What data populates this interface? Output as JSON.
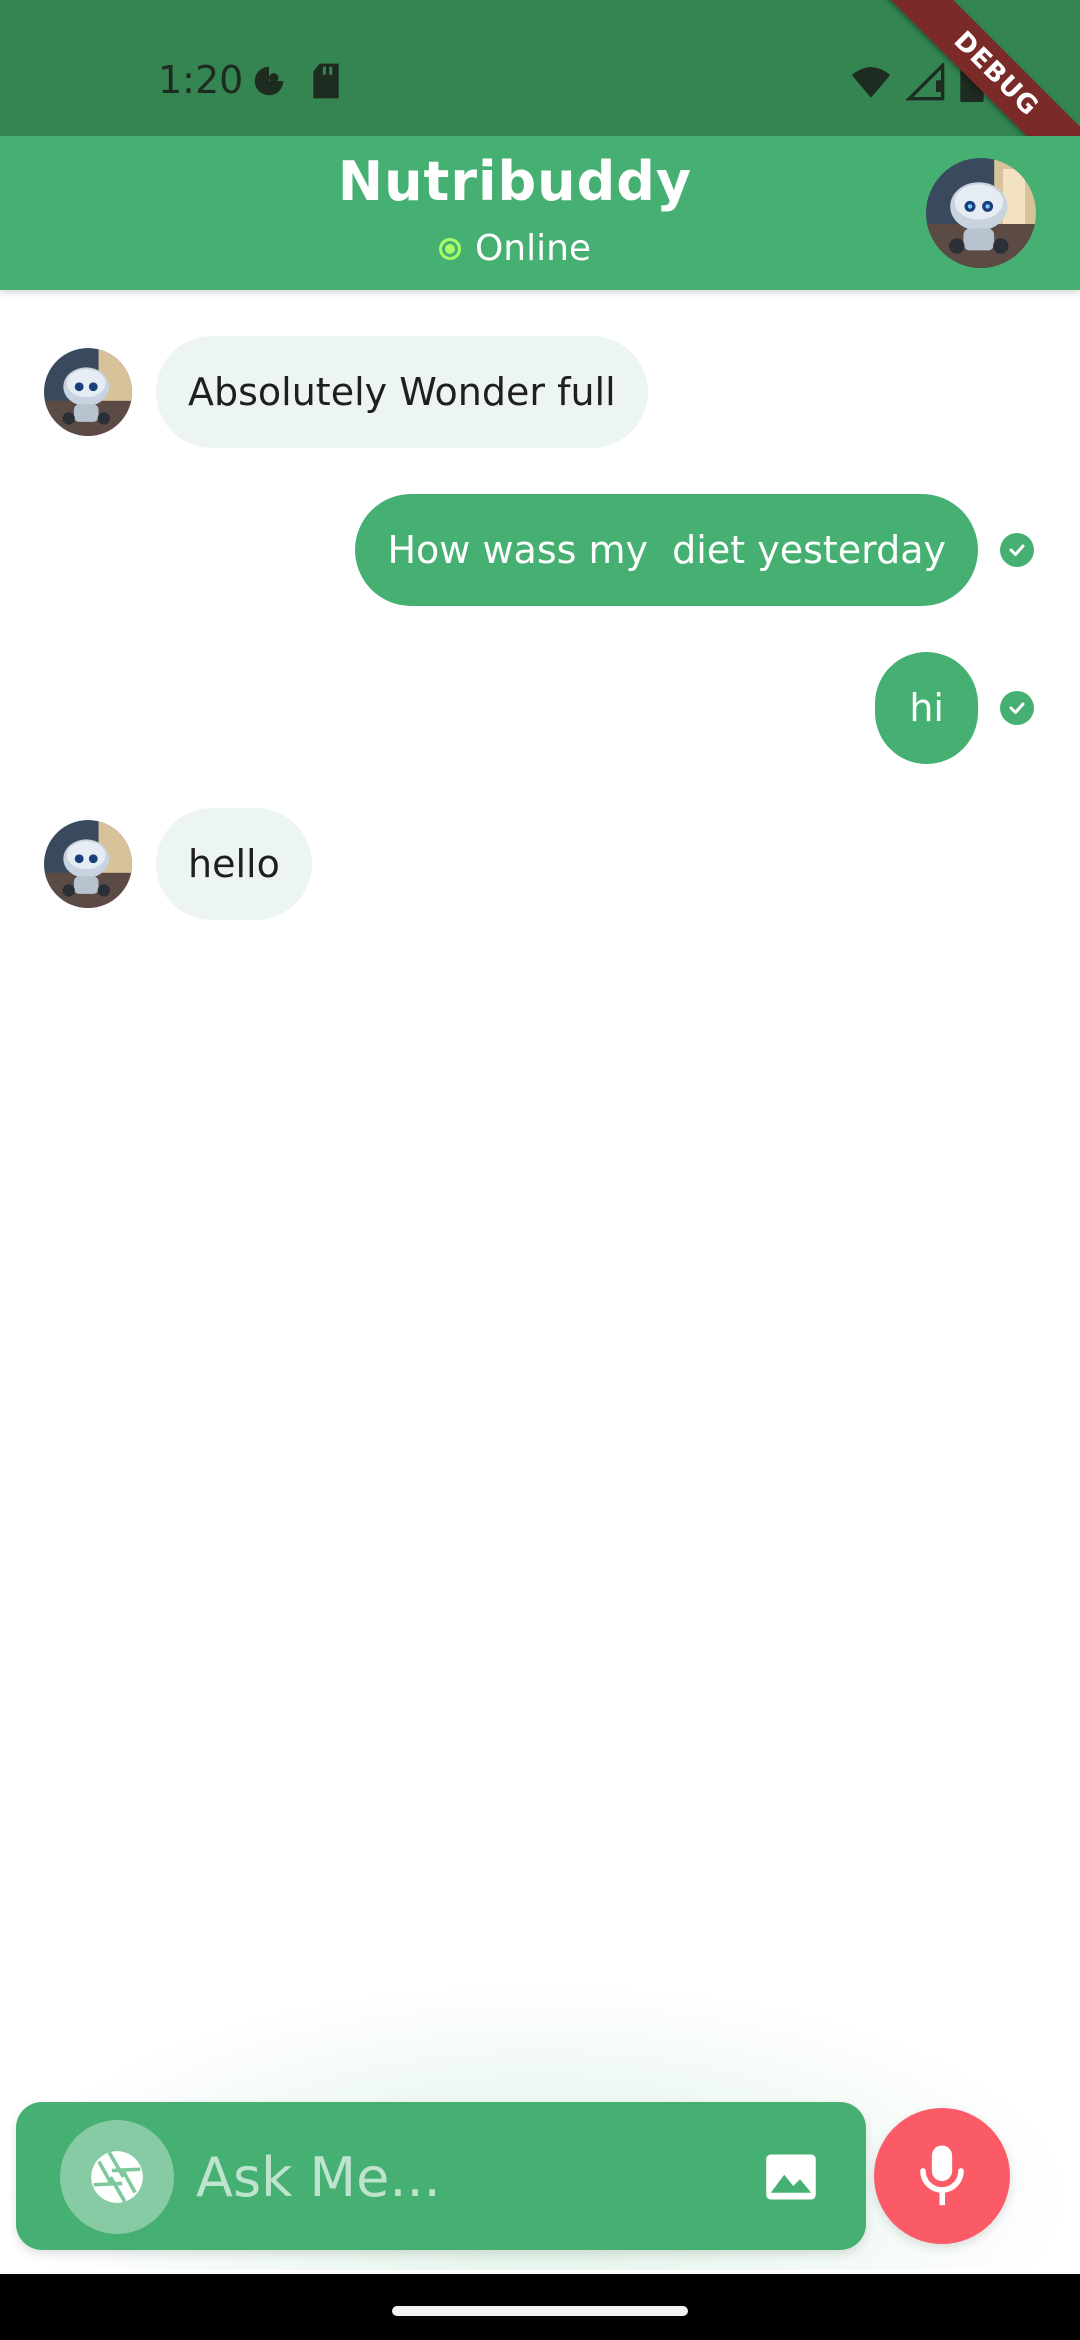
{
  "status_bar": {
    "time": "1:20",
    "left_icons": [
      "pie-chart-icon",
      "sd-card-icon"
    ],
    "right_icons": [
      "wifi-icon",
      "signal-icon",
      "battery-icon"
    ],
    "debug_label": "DEBUG"
  },
  "header": {
    "title": "Nutribuddy",
    "status": "Online",
    "status_color": "#a6ff6b",
    "avatar": "robot-avatar"
  },
  "chat": {
    "messages": [
      {
        "sender": "bot",
        "text": "Absolutely Wonder full"
      },
      {
        "sender": "user",
        "text": "How wass my  diet yesterday",
        "read": true
      },
      {
        "sender": "user",
        "text": "hi",
        "read": true
      },
      {
        "sender": "bot",
        "text": "hello"
      }
    ]
  },
  "input": {
    "placeholder": "Ask Me...",
    "camera_icon": "camera-shutter-icon",
    "gallery_icon": "image-icon",
    "mic_icon": "microphone-icon"
  },
  "colors": {
    "primary": "#46b072",
    "status_bar": "#358553",
    "bubble_in": "#edf5f0",
    "mic": "#fb5a67"
  }
}
